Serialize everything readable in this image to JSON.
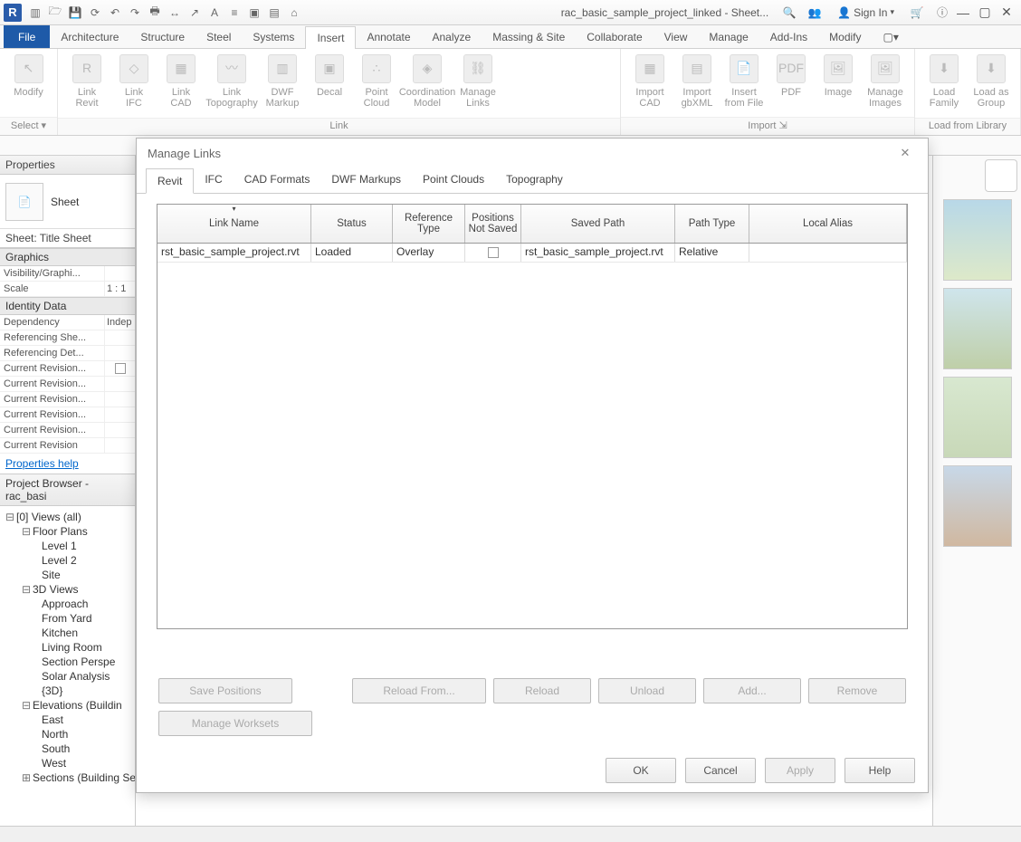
{
  "titlebar": {
    "app_logo": "R",
    "doc_title": "rac_basic_sample_project_linked - Sheet...",
    "signin": "Sign In"
  },
  "ribbon": {
    "tabs": [
      "File",
      "Architecture",
      "Structure",
      "Steel",
      "Systems",
      "Insert",
      "Annotate",
      "Analyze",
      "Massing & Site",
      "Collaborate",
      "View",
      "Manage",
      "Add-Ins",
      "Modify"
    ],
    "active_tab": "Insert",
    "modify_label": "Modify",
    "select_label": "Select",
    "groups": {
      "link": {
        "caption": "Link",
        "tools": [
          "Link\nRevit",
          "Link\nIFC",
          "Link\nCAD",
          "Link\nTopography",
          "DWF\nMarkup",
          "Decal",
          "Point\nCloud",
          "Coordination\nModel",
          "Manage\nLinks"
        ]
      },
      "import": {
        "caption": "Import",
        "tools": [
          "Import\nCAD",
          "Import\ngbXML",
          "Insert\nfrom File",
          "PDF",
          "Image",
          "Manage\nImages"
        ]
      },
      "library": {
        "caption": "Load from Library",
        "tools": [
          "Load\nFamily",
          "Load as\nGroup"
        ]
      }
    }
  },
  "properties": {
    "title": "Properties",
    "type": "Sheet",
    "sheet_label": "Sheet: Title Sheet",
    "sections": {
      "graphics": "Graphics",
      "identity": "Identity Data"
    },
    "rows": [
      {
        "k": "Visibility/Graphi...",
        "v": ""
      },
      {
        "k": "Scale",
        "v": "1 : 1"
      }
    ],
    "identity_rows": [
      {
        "k": "Dependency",
        "v": "Indep"
      },
      {
        "k": "Referencing She...",
        "v": ""
      },
      {
        "k": "Referencing Det...",
        "v": ""
      },
      {
        "k": "Current Revision...",
        "v": "☐"
      },
      {
        "k": "Current Revision...",
        "v": ""
      },
      {
        "k": "Current Revision...",
        "v": ""
      },
      {
        "k": "Current Revision...",
        "v": ""
      },
      {
        "k": "Current Revision...",
        "v": ""
      },
      {
        "k": "Current Revision",
        "v": ""
      }
    ],
    "help": "Properties help"
  },
  "browser": {
    "title": "Project Browser - rac_basi",
    "views_root": "Views (all)",
    "floor_plans": {
      "label": "Floor Plans",
      "items": [
        "Level 1",
        "Level 2",
        "Site"
      ]
    },
    "three_d": {
      "label": "3D Views",
      "items": [
        "Approach",
        "From Yard",
        "Kitchen",
        "Living Room",
        "Section Perspe",
        "Solar Analysis",
        "{3D}"
      ]
    },
    "elevations": {
      "label": "Elevations (Buildin",
      "items": [
        "East",
        "North",
        "South",
        "West"
      ]
    },
    "sections": {
      "label": "Sections (Building Section)"
    }
  },
  "dialog": {
    "title": "Manage Links",
    "tabs": [
      "Revit",
      "IFC",
      "CAD Formats",
      "DWF Markups",
      "Point Clouds",
      "Topography"
    ],
    "active_tab": "Revit",
    "columns": [
      "Link Name",
      "Status",
      "Reference Type",
      "Positions Not Saved",
      "Saved Path",
      "Path Type",
      "Local Alias"
    ],
    "rows": [
      {
        "link_name": "rst_basic_sample_project.rvt",
        "status": "Loaded",
        "ref_type": "Overlay",
        "pos_not_saved": false,
        "saved_path": "rst_basic_sample_project.rvt",
        "path_type": "Relative",
        "local_alias": ""
      }
    ],
    "buttons": {
      "save_positions": "Save Positions",
      "reload_from": "Reload From...",
      "reload": "Reload",
      "unload": "Unload",
      "add": "Add...",
      "remove": "Remove",
      "manage_worksets": "Manage Worksets",
      "ok": "OK",
      "cancel": "Cancel",
      "apply": "Apply",
      "help": "Help"
    }
  }
}
